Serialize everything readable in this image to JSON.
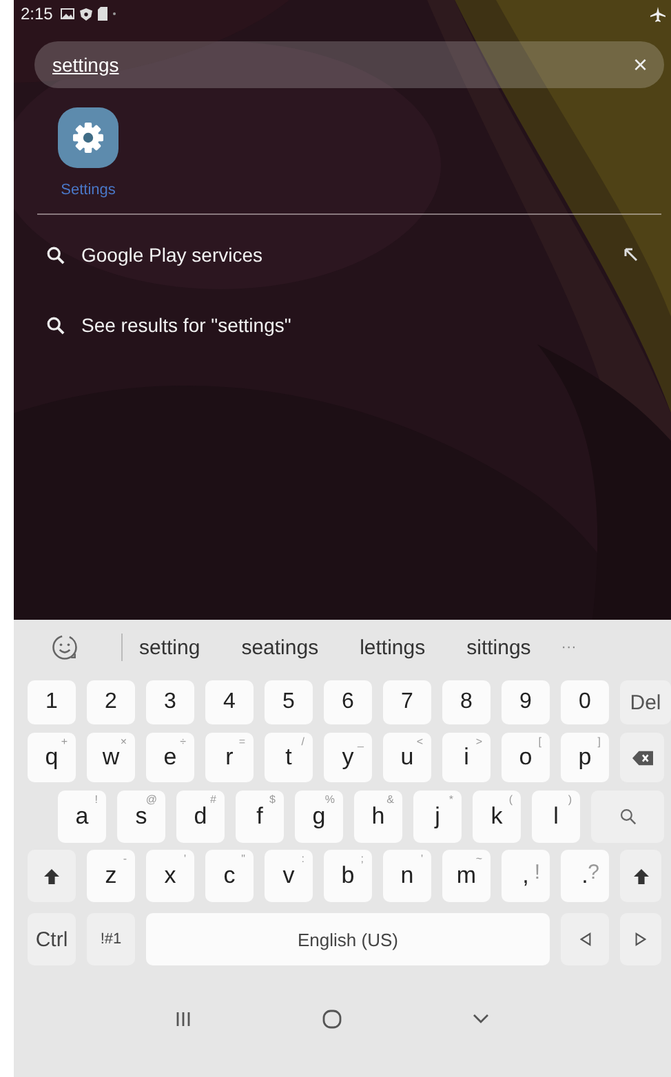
{
  "status_bar": {
    "time": "2:15"
  },
  "search": {
    "value": "settings",
    "clear": "×"
  },
  "apps": [
    {
      "label": "Settings"
    }
  ],
  "results": [
    {
      "text": "Google Play services",
      "insert_arrow": true
    },
    {
      "text": "See results for \"settings\"",
      "insert_arrow": false
    }
  ],
  "keyboard": {
    "suggestions": [
      "setting",
      "seatings",
      "lettings",
      "sittings"
    ],
    "more": "···",
    "rows": [
      {
        "keys": [
          {
            "kind": "char",
            "label": "1"
          },
          {
            "kind": "char",
            "label": "2"
          },
          {
            "kind": "char",
            "label": "3"
          },
          {
            "kind": "char",
            "label": "4"
          },
          {
            "kind": "char",
            "label": "5"
          },
          {
            "kind": "char",
            "label": "6"
          },
          {
            "kind": "char",
            "label": "7"
          },
          {
            "kind": "char",
            "label": "8"
          },
          {
            "kind": "char",
            "label": "9"
          },
          {
            "kind": "char",
            "label": "0"
          },
          {
            "kind": "func",
            "label": "Del"
          }
        ]
      },
      {
        "keys": [
          {
            "kind": "char",
            "label": "q",
            "hint": "+"
          },
          {
            "kind": "char",
            "label": "w",
            "hint": "×"
          },
          {
            "kind": "char",
            "label": "e",
            "hint": "÷"
          },
          {
            "kind": "char",
            "label": "r",
            "hint": "="
          },
          {
            "kind": "char",
            "label": "t",
            "hint": "/"
          },
          {
            "kind": "char",
            "label": "y",
            "hint": "_"
          },
          {
            "kind": "char",
            "label": "u",
            "hint": "<"
          },
          {
            "kind": "char",
            "label": "i",
            "hint": ">"
          },
          {
            "kind": "char",
            "label": "o",
            "hint": "["
          },
          {
            "kind": "char",
            "label": "p",
            "hint": "]"
          },
          {
            "kind": "backspace"
          }
        ]
      },
      {
        "keys": [
          {
            "kind": "char",
            "label": "a",
            "hint": "!"
          },
          {
            "kind": "char",
            "label": "s",
            "hint": "@"
          },
          {
            "kind": "char",
            "label": "d",
            "hint": "#"
          },
          {
            "kind": "char",
            "label": "f",
            "hint": "$"
          },
          {
            "kind": "char",
            "label": "g",
            "hint": "%"
          },
          {
            "kind": "char",
            "label": "h",
            "hint": "&"
          },
          {
            "kind": "char",
            "label": "j",
            "hint": "*"
          },
          {
            "kind": "char",
            "label": "k",
            "hint": "("
          },
          {
            "kind": "char",
            "label": "l",
            "hint": ")"
          },
          {
            "kind": "search"
          }
        ]
      },
      {
        "keys": [
          {
            "kind": "shift"
          },
          {
            "kind": "char",
            "label": "z",
            "hint": "-"
          },
          {
            "kind": "char",
            "label": "x",
            "hint": "'"
          },
          {
            "kind": "char",
            "label": "c",
            "hint": "\""
          },
          {
            "kind": "char",
            "label": "v",
            "hint": ":"
          },
          {
            "kind": "char",
            "label": "b",
            "hint": ";"
          },
          {
            "kind": "char",
            "label": "n",
            "hint": "'"
          },
          {
            "kind": "char",
            "label": "m",
            "hint": "~"
          },
          {
            "kind": "punct",
            "label": ",",
            "hint": "!"
          },
          {
            "kind": "punct",
            "label": ".",
            "hint": "?"
          },
          {
            "kind": "shift"
          }
        ]
      },
      {
        "keys": [
          {
            "kind": "func",
            "label": "Ctrl"
          },
          {
            "kind": "func",
            "label": "!#1"
          },
          {
            "kind": "space",
            "label": "English (US)"
          },
          {
            "kind": "left"
          },
          {
            "kind": "right"
          }
        ]
      }
    ]
  }
}
